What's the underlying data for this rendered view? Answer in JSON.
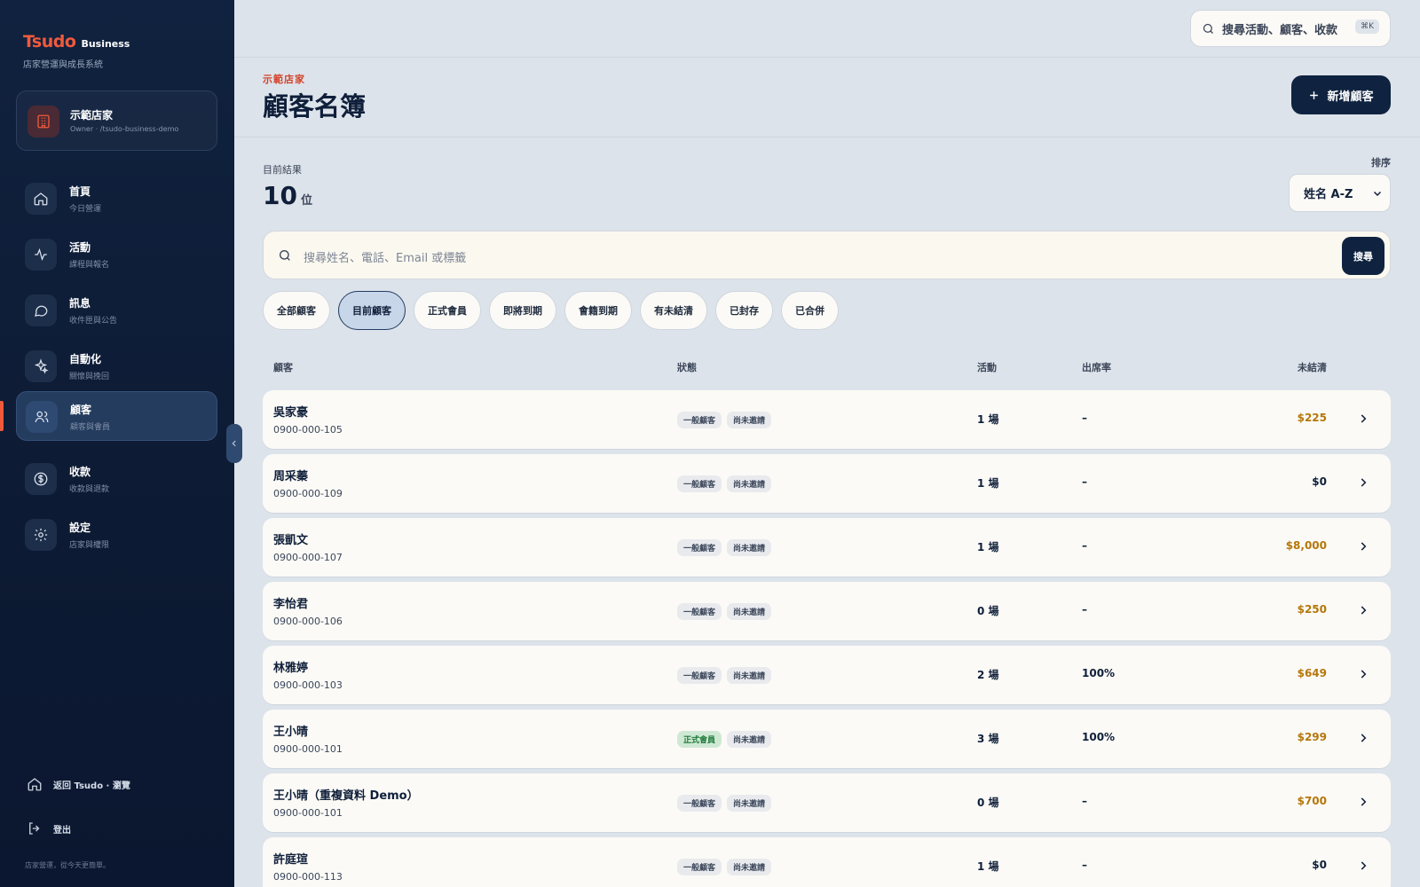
{
  "sidebar": {
    "brand": {
      "logo": "Tsudo",
      "suffix": "Business",
      "tagline": "店家營運與成長系統"
    },
    "store": {
      "name": "示範店家",
      "role": "Owner · /tsudo-business-demo"
    },
    "items": [
      {
        "label": "首頁",
        "sub": "今日營運",
        "icon": "home-icon"
      },
      {
        "label": "活動",
        "sub": "課程與報名",
        "icon": "activity-icon"
      },
      {
        "label": "訊息",
        "sub": "收件匣與公告",
        "icon": "message-icon"
      },
      {
        "label": "自動化",
        "sub": "關懷與挽回",
        "icon": "sparkle-icon"
      },
      {
        "label": "顧客",
        "sub": "顧客與會員",
        "icon": "users-icon"
      },
      {
        "label": "收款",
        "sub": "收款與退款",
        "icon": "dollar-icon"
      },
      {
        "label": "設定",
        "sub": "店家與權限",
        "icon": "gear-icon"
      }
    ],
    "active_index": 4,
    "footer": {
      "back": "返回 Tsudo · 瀏覽",
      "logout": "登出",
      "note": "店家營運，從今天更簡單。"
    }
  },
  "topbar": {
    "search_label": "搜尋活動、顧客、收款",
    "shortcut": "⌘K"
  },
  "header": {
    "eyebrow": "示範店家",
    "title": "顧客名簿",
    "add_button": "新增顧客"
  },
  "summary": {
    "label": "目前結果",
    "count": "10",
    "unit": "位"
  },
  "sort": {
    "label": "排序",
    "value": "姓名 A-Z"
  },
  "search": {
    "placeholder": "搜尋姓名、電話、Email 或標籤",
    "button": "搜尋"
  },
  "filters": [
    "全部顧客",
    "目前顧客",
    "正式會員",
    "即將到期",
    "會籍到期",
    "有未結清",
    "已封存",
    "已合併"
  ],
  "active_filter": 1,
  "table": {
    "columns": {
      "customer": "顧客",
      "status": "狀態",
      "activity": "活動",
      "attendance": "出席率",
      "due": "未結清"
    },
    "rows": [
      {
        "name": "吳家豪",
        "phone": "0900-000-105",
        "type": "一般顧客",
        "invite": "尚未邀請",
        "activity": "1 場",
        "attendance": "–",
        "due": "$225"
      },
      {
        "name": "周采蓁",
        "phone": "0900-000-109",
        "type": "一般顧客",
        "invite": "尚未邀請",
        "activity": "1 場",
        "attendance": "–",
        "due": "$0"
      },
      {
        "name": "張凱文",
        "phone": "0900-000-107",
        "type": "一般顧客",
        "invite": "尚未邀請",
        "activity": "1 場",
        "attendance": "–",
        "due": "$8,000"
      },
      {
        "name": "李怡君",
        "phone": "0900-000-106",
        "type": "一般顧客",
        "invite": "尚未邀請",
        "activity": "0 場",
        "attendance": "–",
        "due": "$250"
      },
      {
        "name": "林雅婷",
        "phone": "0900-000-103",
        "type": "一般顧客",
        "invite": "尚未邀請",
        "activity": "2 場",
        "attendance": "100%",
        "due": "$649"
      },
      {
        "name": "王小晴",
        "phone": "0900-000-101",
        "type": "正式會員",
        "invite": "尚未邀請",
        "activity": "3 場",
        "attendance": "100%",
        "due": "$299"
      },
      {
        "name": "王小晴（重複資料 Demo）",
        "phone": "0900-000-101",
        "type": "一般顧客",
        "invite": "尚未邀請",
        "activity": "0 場",
        "attendance": "–",
        "due": "$700"
      },
      {
        "name": "許庭瑄",
        "phone": "0900-000-113",
        "type": "一般顧客",
        "invite": "尚未邀請",
        "activity": "1 場",
        "attendance": "–",
        "due": "$0"
      }
    ]
  },
  "colors": {
    "accent": "#ef5a3c",
    "navy": "#0f2340",
    "due_positive": "#b5770a",
    "due_zero": "#0f1f3a",
    "member_green": "#1e7a3a"
  }
}
